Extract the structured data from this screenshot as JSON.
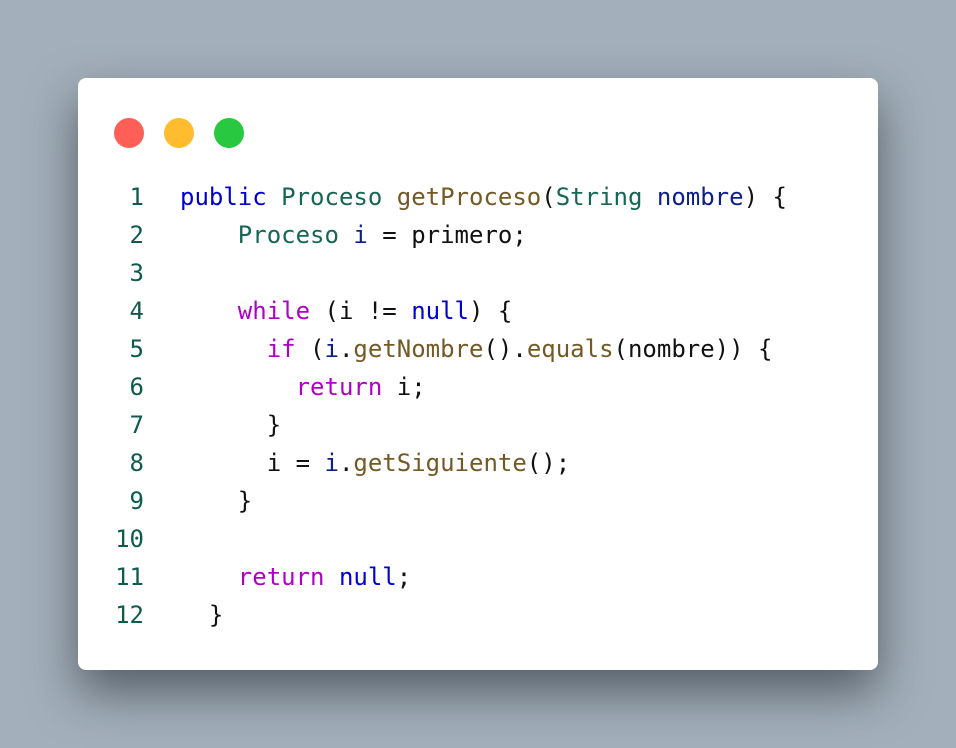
{
  "window_controls": {
    "close_color": "#ff5f57",
    "minimize_color": "#febc2e",
    "maximize_color": "#28c840"
  },
  "colors": {
    "background": "#a3afba",
    "card": "#ffffff",
    "line_number": "#0e5a4e",
    "keyword": "#0000d0",
    "control_keyword": "#b000c8",
    "type": "#166656",
    "function": "#735a25",
    "variable": "#0a1f8a",
    "plain": "#111111"
  },
  "code": {
    "lines": [
      {
        "number": "1",
        "tokens": [
          {
            "t": "public",
            "k": "kw"
          },
          {
            "t": " ",
            "k": "plain"
          },
          {
            "t": "Proceso",
            "k": "type"
          },
          {
            "t": " ",
            "k": "plain"
          },
          {
            "t": "getProceso",
            "k": "fn"
          },
          {
            "t": "(",
            "k": "plain"
          },
          {
            "t": "String",
            "k": "type"
          },
          {
            "t": " ",
            "k": "plain"
          },
          {
            "t": "nombre",
            "k": "var"
          },
          {
            "t": ") {",
            "k": "plain"
          }
        ]
      },
      {
        "number": "2",
        "tokens": [
          {
            "t": "    ",
            "k": "plain"
          },
          {
            "t": "Proceso",
            "k": "type"
          },
          {
            "t": " ",
            "k": "plain"
          },
          {
            "t": "i",
            "k": "var"
          },
          {
            "t": " = primero;",
            "k": "plain"
          }
        ]
      },
      {
        "number": "3",
        "tokens": []
      },
      {
        "number": "4",
        "tokens": [
          {
            "t": "    ",
            "k": "plain"
          },
          {
            "t": "while",
            "k": "kw2"
          },
          {
            "t": " (i != ",
            "k": "plain"
          },
          {
            "t": "null",
            "k": "kw"
          },
          {
            "t": ") {",
            "k": "plain"
          }
        ]
      },
      {
        "number": "5",
        "tokens": [
          {
            "t": "      ",
            "k": "plain"
          },
          {
            "t": "if",
            "k": "kw2"
          },
          {
            "t": " (",
            "k": "plain"
          },
          {
            "t": "i",
            "k": "var"
          },
          {
            "t": ".",
            "k": "plain"
          },
          {
            "t": "getNombre",
            "k": "fn"
          },
          {
            "t": "().",
            "k": "plain"
          },
          {
            "t": "equals",
            "k": "fn"
          },
          {
            "t": "(nombre)) {",
            "k": "plain"
          }
        ]
      },
      {
        "number": "6",
        "tokens": [
          {
            "t": "        ",
            "k": "plain"
          },
          {
            "t": "return",
            "k": "kw2"
          },
          {
            "t": " i;",
            "k": "plain"
          }
        ]
      },
      {
        "number": "7",
        "tokens": [
          {
            "t": "      }",
            "k": "plain"
          }
        ]
      },
      {
        "number": "8",
        "tokens": [
          {
            "t": "      i = ",
            "k": "plain"
          },
          {
            "t": "i",
            "k": "var"
          },
          {
            "t": ".",
            "k": "plain"
          },
          {
            "t": "getSiguiente",
            "k": "fn"
          },
          {
            "t": "();",
            "k": "plain"
          }
        ]
      },
      {
        "number": "9",
        "tokens": [
          {
            "t": "    }",
            "k": "plain"
          }
        ]
      },
      {
        "number": "10",
        "tokens": []
      },
      {
        "number": "11",
        "tokens": [
          {
            "t": "    ",
            "k": "plain"
          },
          {
            "t": "return",
            "k": "kw2"
          },
          {
            "t": " ",
            "k": "plain"
          },
          {
            "t": "null",
            "k": "kw"
          },
          {
            "t": ";",
            "k": "plain"
          }
        ]
      },
      {
        "number": "12",
        "tokens": [
          {
            "t": "  }",
            "k": "plain"
          }
        ]
      }
    ]
  }
}
